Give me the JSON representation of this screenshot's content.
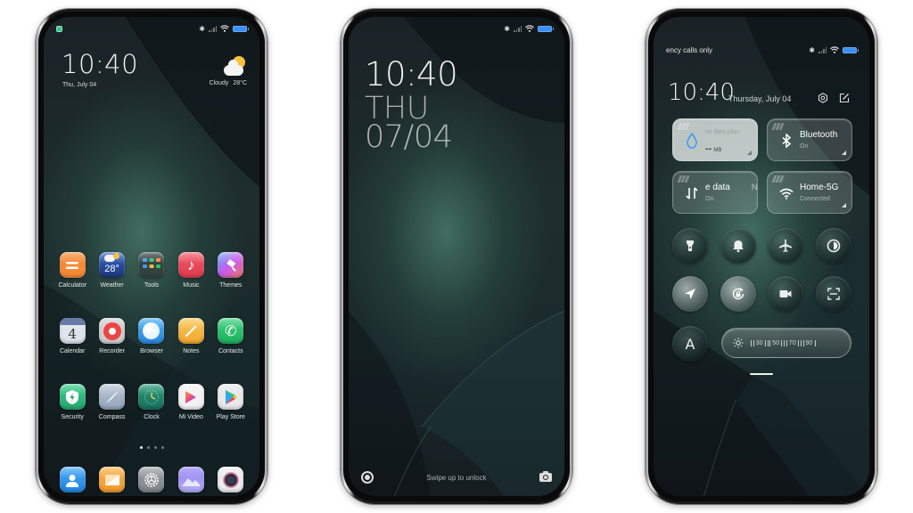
{
  "phones": {
    "home": {
      "statusbar": {
        "notification": "app-notification",
        "icons": [
          "bluetooth-icon",
          "signal-icon",
          "wifi-icon",
          "battery-icon"
        ]
      },
      "clock": "10:40",
      "date": "Thu, July 04",
      "weather": {
        "condition": "Cloudy",
        "temperature": "28°C",
        "icon": "partly-cloudy-icon"
      },
      "apps": [
        {
          "label": "Calculator",
          "icon": "calculator-icon",
          "color": "#f58a35"
        },
        {
          "label": "Weather",
          "icon": "weather-icon",
          "color": "#2c4fa0",
          "badge": "28°"
        },
        {
          "label": "Tools",
          "icon": "tools-folder-icon",
          "color": "#3a4a48"
        },
        {
          "label": "Music",
          "icon": "music-icon",
          "color": "#ee4a5a"
        },
        {
          "label": "Themes",
          "icon": "themes-icon",
          "color": "#c85af0"
        },
        {
          "label": "Calendar",
          "icon": "calendar-icon",
          "color": "#8a93ab",
          "badge": "4"
        },
        {
          "label": "Recorder",
          "icon": "recorder-icon",
          "color": "#c9c9c9"
        },
        {
          "label": "Browser",
          "icon": "browser-icon",
          "color": "#3b9ef0"
        },
        {
          "label": "Notes",
          "icon": "notes-icon",
          "color": "#f5b640"
        },
        {
          "label": "Contacts",
          "icon": "phone-icon",
          "color": "#25c26b"
        },
        {
          "label": "Security",
          "icon": "security-shield-icon",
          "color": "#2fb97c"
        },
        {
          "label": "Compass",
          "icon": "compass-icon",
          "color": "#a9b7c9"
        },
        {
          "label": "Clock",
          "icon": "clock-icon",
          "color": "#1f8a6a"
        },
        {
          "label": "Mi Video",
          "icon": "mi-video-icon",
          "color": "#f0f0f0"
        },
        {
          "label": "Play Store",
          "icon": "play-store-icon",
          "color": "#e4e4e4"
        }
      ],
      "page_indicator": {
        "pages": 4,
        "current": 1
      },
      "dock": [
        {
          "icon": "contacts-person-icon",
          "color": "#2f95ea"
        },
        {
          "icon": "messages-icon",
          "color": "#f5a23a"
        },
        {
          "icon": "settings-gear-icon",
          "color": "#8f9599"
        },
        {
          "icon": "gallery-icon",
          "color": "#9b8ef0"
        },
        {
          "icon": "camera-lens-icon",
          "color": "#e6e6e6"
        }
      ]
    },
    "lock": {
      "time": "10:40",
      "day": "THU",
      "date": "07/04",
      "hint": "Swipe up to unlock"
    },
    "control": {
      "carrier": "ency calls only",
      "time": "10:40",
      "date": "Thursday, July 04",
      "tiles": [
        {
          "title": "vn data plan",
          "sub_value": "--",
          "sub_unit": "MB",
          "icon": "data-drop-icon",
          "active": true
        },
        {
          "title": "Bluetooth",
          "sub": "On",
          "icon": "bluetooth-icon",
          "active": false
        },
        {
          "title": "e data",
          "title_suffix": "N",
          "sub": "On",
          "icon": "mobile-data-arrows-icon",
          "active": false
        },
        {
          "title": "Home-5G",
          "sub": "Connected",
          "icon": "wifi-icon",
          "active": false
        }
      ],
      "toggles": [
        {
          "name": "flashlight",
          "icon": "flashlight-icon",
          "on": false
        },
        {
          "name": "mute",
          "icon": "bell-icon",
          "on": false
        },
        {
          "name": "airplane",
          "icon": "airplane-icon",
          "on": false
        },
        {
          "name": "dark-mode",
          "icon": "contrast-icon",
          "on": false
        },
        {
          "name": "location",
          "icon": "location-arrow-icon",
          "on": true
        },
        {
          "name": "rotation-lock",
          "icon": "rotation-lock-icon",
          "on": true
        },
        {
          "name": "screen-recorder",
          "icon": "video-camera-icon",
          "on": false
        },
        {
          "name": "scanner",
          "icon": "scan-frame-icon",
          "on": false
        }
      ],
      "font_toggle": "A",
      "brightness": {
        "scale": [
          "30",
          "50",
          "70",
          "90"
        ]
      }
    }
  },
  "colors": {
    "accent_battery": "#3d8ef5",
    "wallpaper_teal": "#3f6f62"
  }
}
